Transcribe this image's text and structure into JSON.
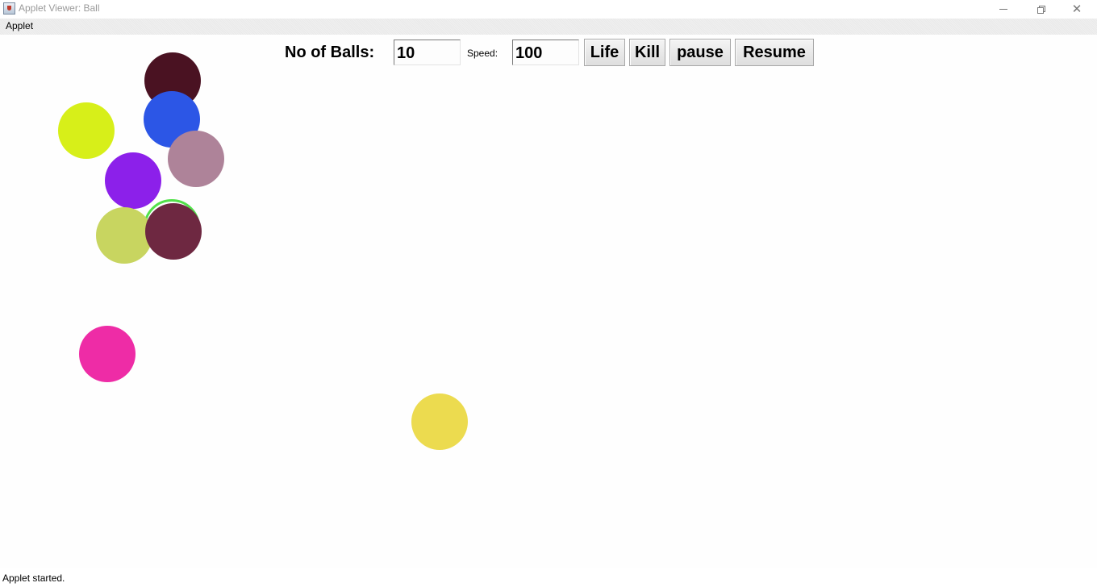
{
  "window": {
    "title": "Applet Viewer: Ball",
    "icon": "java-cup-icon",
    "controls": {
      "minimize_icon": "minimize-icon",
      "maximize_icon": "restore-icon",
      "close_icon": "close-icon",
      "close_glyph": "✕"
    }
  },
  "menubar": {
    "items": [
      {
        "label": "Applet"
      }
    ]
  },
  "controls": {
    "balls_label": "No of Balls:",
    "balls_value": "10",
    "speed_label": "Speed:",
    "speed_value": "100",
    "life_label": "Life",
    "kill_label": "Kill",
    "pause_label": "pause",
    "resume_label": "Resume"
  },
  "balls": [
    {
      "color": "#4a1222"
    },
    {
      "color": "#d7ef19"
    },
    {
      "color": "#2c56e6"
    },
    {
      "color": "#ae8399"
    },
    {
      "color": "#8c20ea"
    },
    {
      "color": "#52e14a",
      "style": "ring"
    },
    {
      "color": "#c8d560"
    },
    {
      "color": "#6e2841"
    },
    {
      "color": "#ee2ca6"
    },
    {
      "color": "#ecdb4f"
    }
  ],
  "status": {
    "text": "Applet started."
  }
}
